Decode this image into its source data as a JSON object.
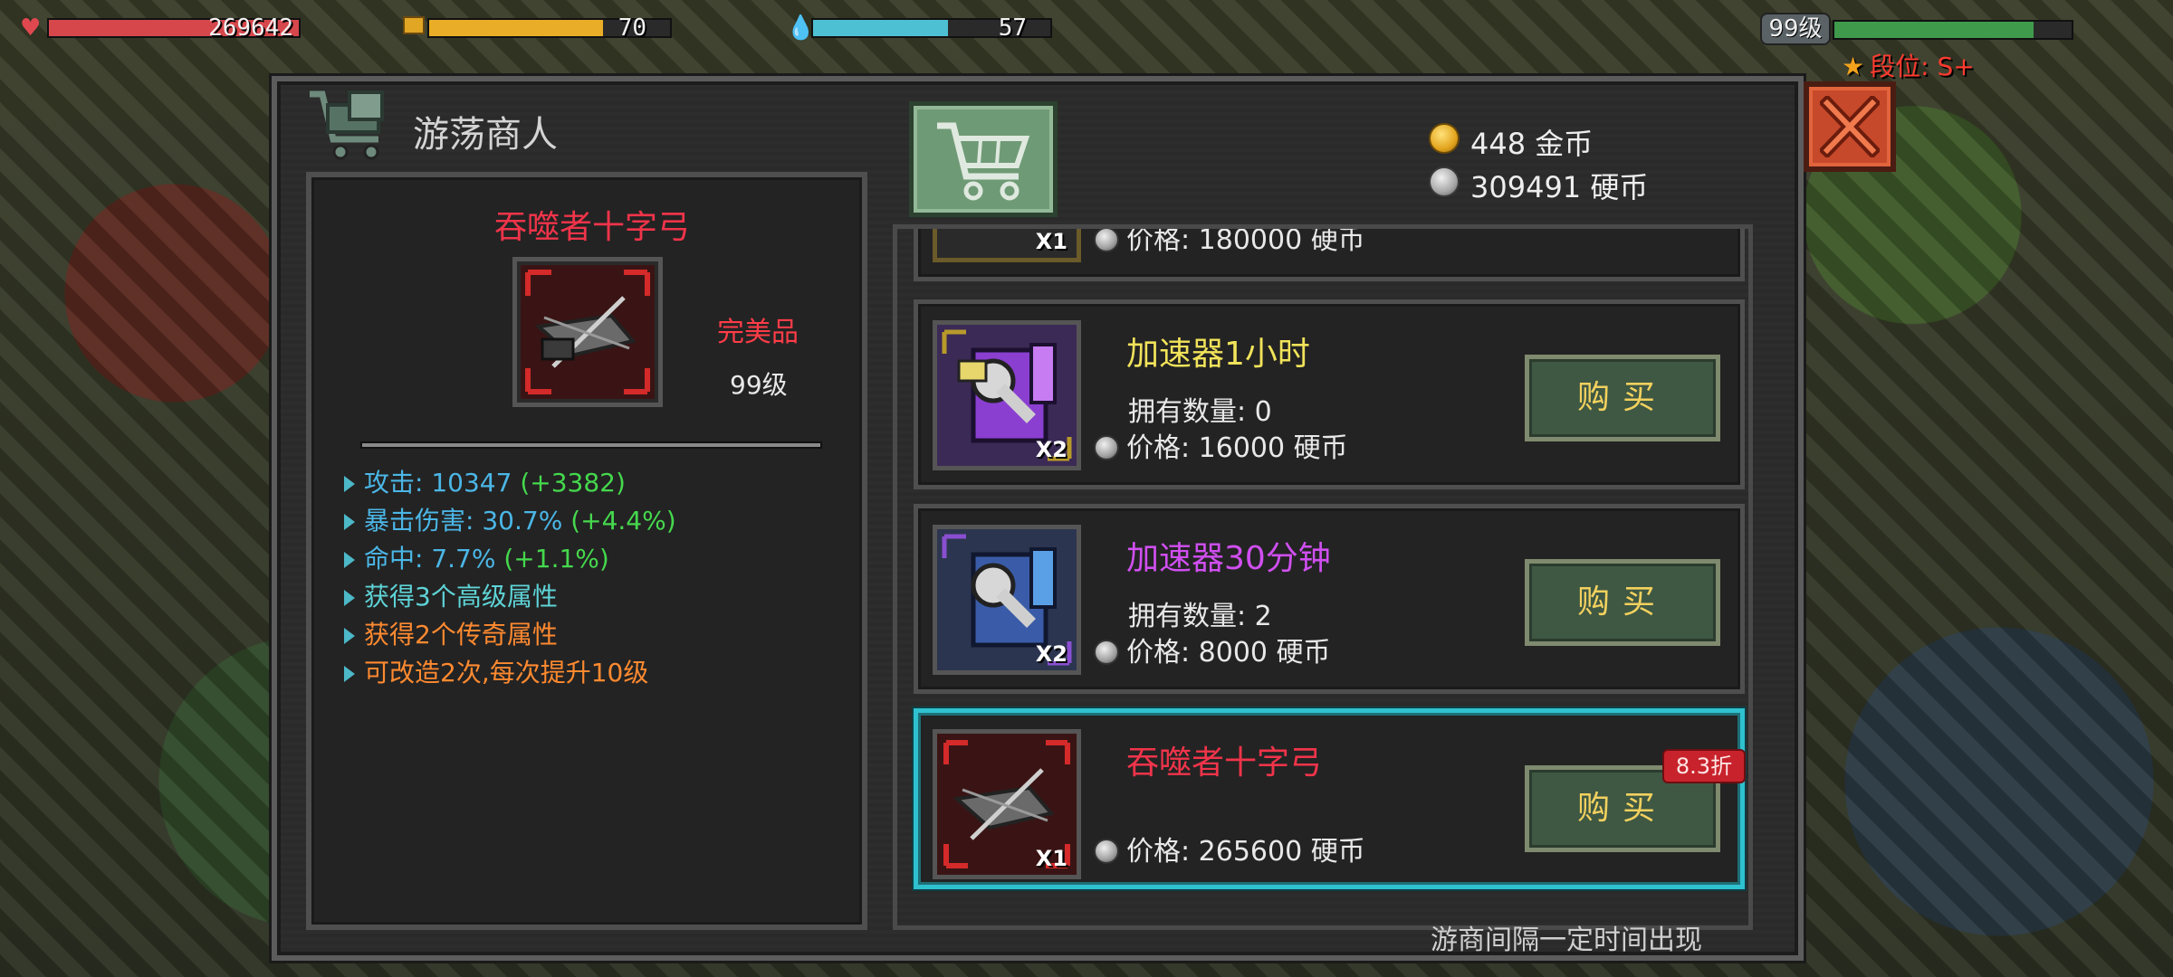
{
  "hud": {
    "hp_value": "269642",
    "food_value": "70",
    "water_value": "57",
    "level": "99级",
    "rank": "段位: S+",
    "colors": {
      "hp": "#d6474c",
      "food": "#e9ad27",
      "water": "#4ec0d3",
      "xp": "#3f9a4c"
    }
  },
  "shop": {
    "title": "游荡商人",
    "gold": "448 金币",
    "coins": "309491 硬币",
    "note": "游商间隔一定时间出现"
  },
  "detail": {
    "name": "吞噬者十字弓",
    "quality": "完美品",
    "level": "99级",
    "stats": [
      {
        "label": "攻击: ",
        "value": "10347",
        "bonus": " (+3382)"
      },
      {
        "label": "暴击伤害: ",
        "value": "30.7%",
        "bonus": " (+4.4%)"
      },
      {
        "label": "命中: ",
        "value": "7.7%",
        "bonus": " (+1.1%)"
      }
    ],
    "perks": [
      "获得3个高级属性",
      "获得2个传奇属性",
      "可改造2次,每次提升10级"
    ]
  },
  "items": [
    {
      "name": "",
      "qty": "X1",
      "price": "价格: 180000 硬币"
    },
    {
      "name": "加速器1小时",
      "qty": "X2",
      "owned": "拥有数量: 0",
      "price": "价格: 16000 硬币",
      "buy": "购买"
    },
    {
      "name": "加速器30分钟",
      "qty": "X2",
      "owned": "拥有数量: 2",
      "price": "价格: 8000 硬币",
      "buy": "购买"
    },
    {
      "name": "吞噬者十字弓",
      "qty": "X1",
      "price": "价格: 265600 硬币",
      "buy": "购买",
      "discount": "8.3折"
    }
  ]
}
